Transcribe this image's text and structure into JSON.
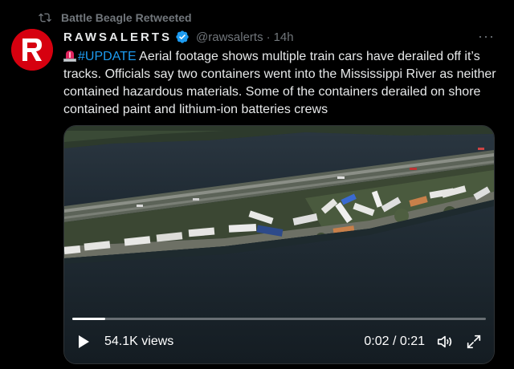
{
  "retweet": {
    "icon": "retweet-icon",
    "label": "Battle Beagle Retweeted"
  },
  "author": {
    "display_name": "RAWSALERTS",
    "handle": "@rawsalerts",
    "separator": "·",
    "time": "14h",
    "verified_icon": "verified-badge-icon",
    "avatar_icon": "rawsalerts-logo"
  },
  "more_label": "···",
  "tweet": {
    "emoji_icon": "rotating-light-icon",
    "hashtag": "#UPDATE",
    "text": " Aerial footage shows multiple train cars have derailed off it’s tracks. Officials say two containers went into the Mississippi River as neither contained hazardous materials. Some of the containers derailed on shore contained paint and lithium-ion batteries crews"
  },
  "video": {
    "views": "54.1K views",
    "time_readout": "0:02 / 0:21",
    "progress": 0.08,
    "icons": [
      "play-icon",
      "volume-icon",
      "fullscreen-icon"
    ]
  },
  "colors": {
    "background": "#000000",
    "text": "#e7e9ea",
    "muted": "#71767b",
    "accent": "#1d9bf0",
    "brand": "#d6000f"
  }
}
